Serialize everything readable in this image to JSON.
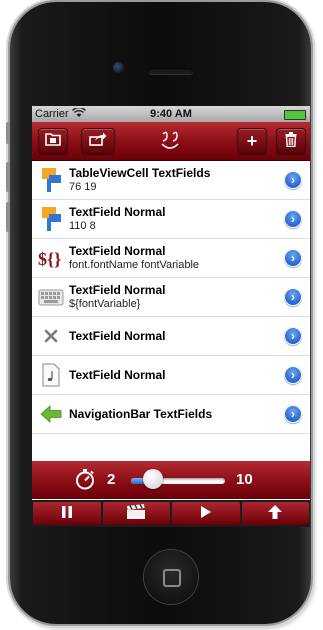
{
  "status": {
    "carrier": "Carrier",
    "time": "9:40 AM"
  },
  "navbar": {
    "title_icon": "signature-icon",
    "left_buttons": [
      "folder-icon",
      "share-icon"
    ],
    "right_buttons": [
      "plus-icon",
      "trash-icon"
    ]
  },
  "rows": [
    {
      "title": "TableViewCell TextFields",
      "subtitle": "76 19",
      "icon": "flag-icon"
    },
    {
      "title": "TextField Normal",
      "subtitle": "110 8",
      "icon": "flag-icon"
    },
    {
      "title": "TextField Normal",
      "subtitle": "font.fontName fontVariable",
      "icon": "variable-icon"
    },
    {
      "title": "TextField Normal",
      "subtitle": "${fontVariable}",
      "icon": "keyboard-icon"
    },
    {
      "title": "TextField Normal",
      "subtitle": "",
      "icon": "x-icon"
    },
    {
      "title": "TextField Normal",
      "subtitle": "",
      "icon": "note-icon"
    },
    {
      "title": "NavigationBar TextFields",
      "subtitle": "",
      "icon": "arrow-left-icon"
    }
  ],
  "slider": {
    "min_label": "2",
    "max_label": "10",
    "fraction": 0.15
  },
  "toolbar": {
    "buttons": [
      "pause-icon",
      "clapper-icon",
      "play-icon",
      "upload-arrow-icon"
    ]
  },
  "colors": {
    "accent": "#8c0f18",
    "disclosure": "#2e6fd6"
  }
}
